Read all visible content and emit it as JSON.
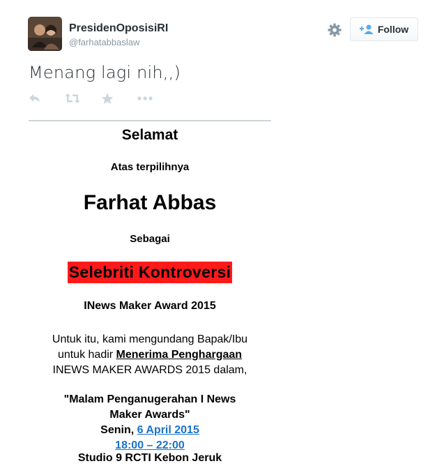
{
  "user": {
    "display_name": "PresidenOposisiRI",
    "handle": "@farhatabbaslaw"
  },
  "follow_button": {
    "label": "Follow"
  },
  "tweet": {
    "text": "Menang lagi nih,,)"
  },
  "actions": [
    {
      "name": "reply-icon"
    },
    {
      "name": "retweet-icon"
    },
    {
      "name": "favorite-icon"
    },
    {
      "name": "more-icon"
    }
  ],
  "invitation": {
    "heading": "Selamat",
    "subheading": "Atas terpilihnya",
    "recipient": "Farhat Abbas",
    "as_label": "Sebagai",
    "award_title": "Selebriti Kontroversi",
    "award_event": "INews Maker Award 2015",
    "invite_line1": "Untuk itu, kami mengundang Bapak/Ibu",
    "invite_line2_prefix": "untuk hadir ",
    "invite_line2_underlined": "Menerima Penghargaan",
    "invite_line3": "INEWS MAKER AWARDS 2015 dalam,",
    "ceremony_line1": "\"Malam Penganugerahan I News",
    "ceremony_line2": "Maker Awards\"",
    "date_prefix": "Senin, ",
    "date_link": "6 April 2015",
    "time_link": "18:00 – 22:00",
    "venue": "Studio 9 RCTI Kebon Jeruk"
  },
  "colors": {
    "highlight": "#ff1a1a",
    "link": "#1a73c8",
    "icon": "#ccd6dd",
    "muted": "#8899a6"
  }
}
